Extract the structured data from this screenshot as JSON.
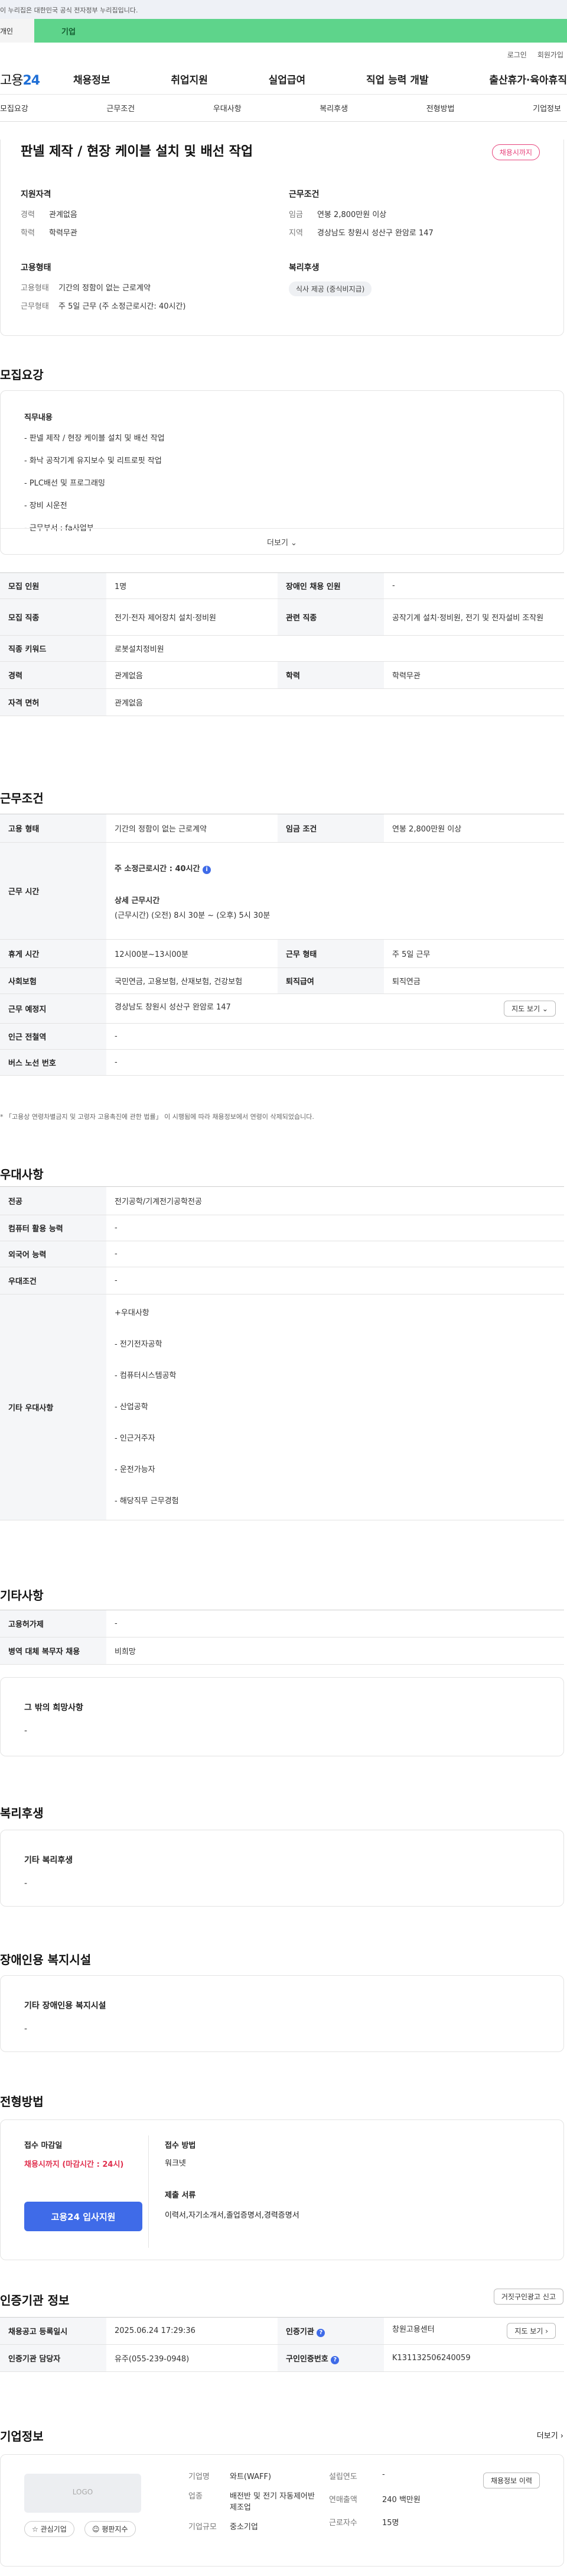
{
  "gov_banner": "이 누리집은 대한민국 공식 전자정부 누리집입니다.",
  "sitebar": {
    "personal": "개인",
    "business": "기업"
  },
  "toplinks": {
    "login": "로그인",
    "signup": "회원가입"
  },
  "logo": {
    "main": "고용",
    "num": "24"
  },
  "gnb": [
    "채용정보",
    "취업지원",
    "실업급여",
    "직업 능력 개발",
    "출산휴가·육아휴직"
  ],
  "tabs": [
    "모집요강",
    "근무조건",
    "우대사항",
    "복리후생",
    "전형방법",
    "기업정보"
  ],
  "hero": {
    "title": "판넬 제작 / 현장 케이블 설치 및 배선 작업",
    "badge": "채용시까지",
    "qual": {
      "title": "지원자격",
      "rows": [
        {
          "k": "경력",
          "v": "관계없음"
        },
        {
          "k": "학력",
          "v": "학력무관"
        }
      ]
    },
    "cond": {
      "title": "근무조건",
      "rows": [
        {
          "k": "임금",
          "v": "연봉 2,800만원 이상"
        },
        {
          "k": "지역",
          "v": "경상남도 창원시 성산구 완암로 147"
        }
      ]
    },
    "emp": {
      "title": "고용형태",
      "rows": [
        {
          "k": "고용형태",
          "v": "기간의 정함이 없는 근로계약"
        },
        {
          "k": "근무형태",
          "v": "주 5일 근무 (주 소정근로시간: 40시간)"
        }
      ]
    },
    "welfare": {
      "title": "복리후생",
      "tag": "식사 제공 (중식비지급)"
    }
  },
  "recruit": {
    "title": "모집요강",
    "duty_heading": "직무내용",
    "duties": [
      "- 판넬 제작 / 현장 케이블 설치 및 배선 작업",
      "- 화낙 공작기계 유지보수 및 리트로핏 작업",
      "- PLC배선 및 프로그래밍",
      "- 장비 시운전",
      "- 근무부서 : fa사업부"
    ],
    "more": "더보기 ⌄",
    "table": [
      {
        "h1": "모집 인원",
        "v1": "1명",
        "h2": "장애인 채용 인원",
        "v2": "-"
      },
      {
        "h1": "모집 직종",
        "v1": "전기·전자 제어장치 설치·정비원",
        "h2": "관련 직종",
        "v2": "공작기계 설치·정비원, 전기 및 전자설비 조작원"
      },
      {
        "h1": "직종 키워드",
        "v1": "로봇설치정비원"
      },
      {
        "h1": "경력",
        "v1": "관계없음",
        "h2": "학력",
        "v2": "학력무관"
      },
      {
        "h1": "자격 면허",
        "v1": "관계없음"
      }
    ]
  },
  "work": {
    "title": "근무조건",
    "emp_type_h": "고용 형태",
    "emp_type": "기간의 정함이 없는 근로계약",
    "wage_h": "임금 조건",
    "wage": "연봉 2,800만원 이상",
    "hours_h": "근무 시간",
    "hours_weekly": "주 소정근로시간 : 40시간",
    "hours_detail_h": "상세 근무시간",
    "hours_detail": "(근무시간) (오전) 8시 30분 ~ (오후) 5시 30분",
    "rest_h": "휴게 시간",
    "rest": "12시00분~13시00분",
    "form_h": "근무 형태",
    "form": "주 5일 근무",
    "ins_h": "사회보험",
    "ins": "국민연금, 고용보험, 산재보험, 건강보험",
    "retire_h": "퇴직급여",
    "retire": "퇴직연금",
    "place_h": "근무 예정지",
    "place": "경상남도 창원시 성산구 완암로 147",
    "map_btn": "지도 보기 ⌄",
    "subway_h": "인근 전철역",
    "subway": "-",
    "bus_h": "버스 노선 번호",
    "bus": "-",
    "note": "* 「고용상 연령차별금지 및 고령자 고용촉진에 관한 법률」 이 시행됨에 따라 채용정보에서 연령이 삭제되었습니다."
  },
  "pref": {
    "title": "우대사항",
    "rows": [
      {
        "h": "전공",
        "v": "전기공학/기계전기공학전공"
      },
      {
        "h": "컴퓨터 활용 능력",
        "v": "-"
      },
      {
        "h": "외국어 능력",
        "v": "-"
      },
      {
        "h": "우대조건",
        "v": "-"
      }
    ],
    "etc_h": "기타 우대사항",
    "etc": [
      "+우대사항",
      "- 전기전자공학",
      "- 컴퓨터시스템공학",
      "- 산업공학",
      "- 인근거주자",
      "- 운전가능자",
      "- 해당직무 근무경험"
    ]
  },
  "misc": {
    "title": "기타사항",
    "rows": [
      {
        "h": "고용허가제",
        "v": "-"
      },
      {
        "h": "병역 대체 복무자 채용",
        "v": "비희망"
      }
    ],
    "other_title": "그 밖의 희망사항",
    "other": "-"
  },
  "welfare": {
    "title": "복리후생",
    "box_title": "기타 복리후생",
    "box_value": "-"
  },
  "disabled": {
    "title": "장애인용 복지시설",
    "box_title": "기타 장애인용 복지시설",
    "box_value": "-"
  },
  "selection": {
    "title": "전형방법",
    "deadline_h": "접수 마감일",
    "deadline": "채용시까지 (마감시간 : 24시)",
    "method_h": "접수 방법",
    "method": "워크넷",
    "docs_h": "제출 서류",
    "docs": "이력서,자기소개서,졸업증명서,경력증명서",
    "apply": "고용24 입사지원"
  },
  "cert": {
    "title": "인증기관 정보",
    "report_btn": "거짓구인광고 신고",
    "reg_h": "채용공고 등록일시",
    "reg": "2025.06.24 17:29:36",
    "org_h": "인증기관",
    "org": "창원고용센터",
    "map_btn": "지도 보기 ›",
    "mgr_h": "인증기관 담당자",
    "mgr": "유주(055-239-0948)",
    "num_h": "구인인증번호",
    "num": "K131132506240059"
  },
  "company": {
    "title": "기업정보",
    "more": "더보기 ›",
    "logo": "LOGO",
    "fav": "☆ 관심기업",
    "review": "☺ 평판지수",
    "rows": [
      {
        "k": "기업명",
        "v": "와트(WAFF)"
      },
      {
        "k": "업종",
        "v": "배전반 및 전기 자동제어반 제조업"
      },
      {
        "k": "기업규모",
        "v": "중소기업"
      }
    ],
    "rows2": [
      {
        "k": "설립연도",
        "v": "-"
      },
      {
        "k": "연매출액",
        "v": "240 백만원"
      },
      {
        "k": "근로자수",
        "v": "15명"
      }
    ],
    "btn": "채용정보 이력"
  }
}
